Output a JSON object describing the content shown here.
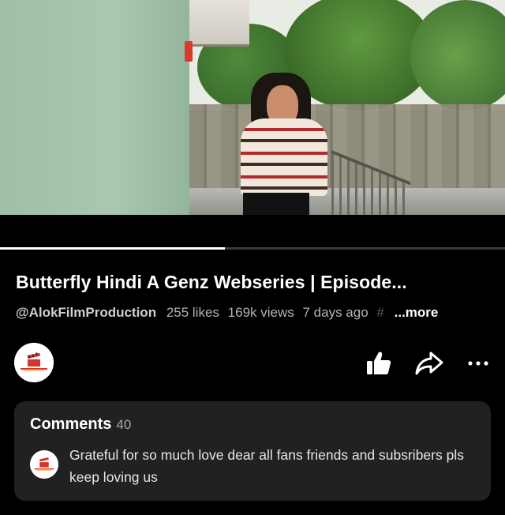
{
  "video": {
    "progress_fraction": 0.445
  },
  "info": {
    "title": "Butterfly Hindi A Genz Webseries | Episode...",
    "channel": "@AlokFilmProduction",
    "likes": "255 likes",
    "views": "169k views",
    "age": "7 days ago",
    "hashtag_glyph": "#",
    "more_label": "...more"
  },
  "actions": {
    "avatar_icon": "film-clapper-logo",
    "like_icon": "thumbs-up-icon",
    "share_icon": "share-arrow-icon",
    "menu_icon": "more-horizontal-icon"
  },
  "comments": {
    "heading": "Comments",
    "count": "40",
    "top_comment": {
      "text": "Grateful for so much love dear all fans friends and subsribers pls keep loving us"
    }
  },
  "colors": {
    "background": "#000000",
    "card": "#212121",
    "meta_text": "#b3b3b3",
    "logo_red": "#d8342b"
  }
}
